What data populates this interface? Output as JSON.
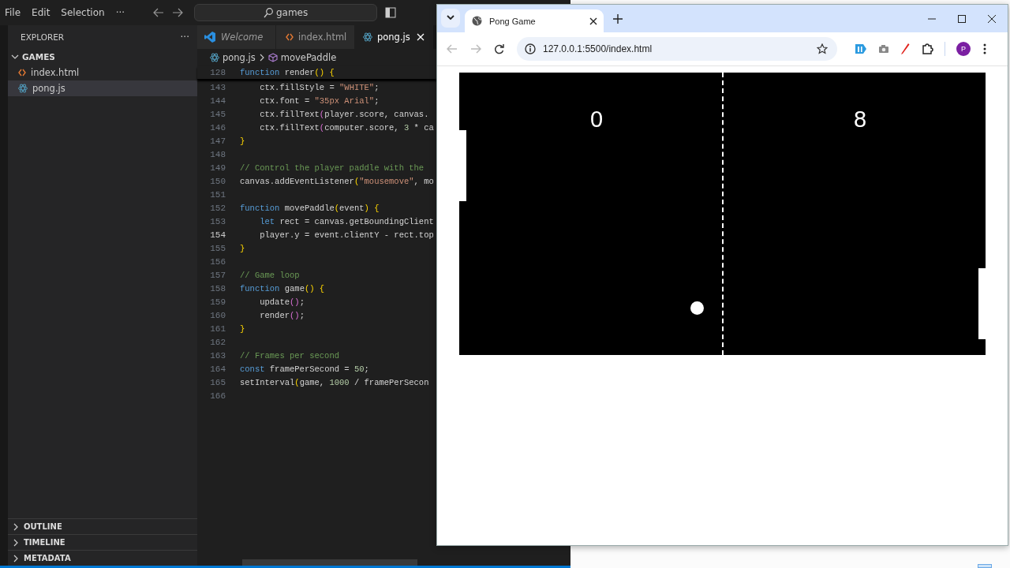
{
  "editor_window": {
    "menu": [
      "File",
      "Edit",
      "Selection",
      "···"
    ],
    "search": {
      "value": "games"
    },
    "explorer": {
      "title": "EXPLORER",
      "more": "···",
      "folder": {
        "name": "GAMES",
        "expanded": true,
        "children": [
          {
            "name": "index.html",
            "kind": "html",
            "selected": false
          },
          {
            "name": "pong.js",
            "kind": "js",
            "selected": true
          }
        ]
      }
    },
    "panels": [
      {
        "name": "OUTLINE",
        "expanded": false
      },
      {
        "name": "TIMELINE",
        "expanded": false
      },
      {
        "name": "METADATA",
        "expanded": false
      }
    ],
    "tabs": [
      {
        "label": "Welcome",
        "kind": "welcome",
        "selected": false
      },
      {
        "label": "index.html",
        "kind": "html",
        "selected": false
      },
      {
        "label": "pong.js",
        "kind": "js",
        "selected": true
      }
    ],
    "breadcrumb": [
      {
        "label": "pong.js",
        "kind": "js"
      },
      {
        "label": "movePaddle",
        "kind": "method"
      }
    ],
    "code": {
      "sticky": {
        "number": "128",
        "tokens": [
          {
            "kind": "kw",
            "text": "function"
          },
          {
            "kind": "p",
            "text": " render"
          },
          {
            "kind": "b1",
            "text": "() {"
          }
        ]
      },
      "lines": [
        {
          "number": "143",
          "current": false,
          "tokens": [
            {
              "kind": "p",
              "text": "    ctx.fillStyle = "
            },
            {
              "kind": "s",
              "text": "\"WHITE\""
            },
            {
              "kind": "p",
              "text": ";"
            }
          ]
        },
        {
          "number": "144",
          "current": false,
          "tokens": [
            {
              "kind": "p",
              "text": "    ctx.font = "
            },
            {
              "kind": "s",
              "text": "\"35px Arial\""
            },
            {
              "kind": "p",
              "text": ";"
            }
          ]
        },
        {
          "number": "145",
          "current": false,
          "tokens": [
            {
              "kind": "p",
              "text": "    ctx.fillText"
            },
            {
              "kind": "b2",
              "text": "("
            },
            {
              "kind": "p",
              "text": "player.score, canvas."
            }
          ]
        },
        {
          "number": "146",
          "current": false,
          "tokens": [
            {
              "kind": "p",
              "text": "    ctx.fillText"
            },
            {
              "kind": "b2",
              "text": "("
            },
            {
              "kind": "p",
              "text": "computer.score, "
            },
            {
              "kind": "n",
              "text": "3"
            },
            {
              "kind": "p",
              "text": " * ca"
            }
          ]
        },
        {
          "number": "147",
          "current": false,
          "tokens": [
            {
              "kind": "b1",
              "text": "}"
            }
          ]
        },
        {
          "number": "148",
          "current": false
        },
        {
          "number": "149",
          "current": false,
          "tokens": [
            {
              "kind": "c",
              "text": "// Control the player paddle with the"
            }
          ]
        },
        {
          "number": "150",
          "current": false,
          "tokens": [
            {
              "kind": "p",
              "text": "canvas.addEventListener"
            },
            {
              "kind": "b1",
              "text": "("
            },
            {
              "kind": "s",
              "text": "\"mousemove\""
            },
            {
              "kind": "p",
              "text": ", mo"
            }
          ]
        },
        {
          "number": "151",
          "current": false
        },
        {
          "number": "152",
          "current": false,
          "tokens": [
            {
              "kind": "kw",
              "text": "function"
            },
            {
              "kind": "p",
              "text": " movePaddle"
            },
            {
              "kind": "b1",
              "text": "("
            },
            {
              "kind": "p",
              "text": "event"
            },
            {
              "kind": "b1",
              "text": ") {"
            }
          ]
        },
        {
          "number": "153",
          "current": false,
          "tokens": [
            {
              "kind": "kw",
              "text": "    let"
            },
            {
              "kind": "p",
              "text": " rect = canvas.getBoundingClient"
            }
          ]
        },
        {
          "number": "154",
          "current": true,
          "tokens": [
            {
              "kind": "p",
              "text": "    player.y = event.clientY - rect.top"
            }
          ]
        },
        {
          "number": "155",
          "current": false,
          "tokens": [
            {
              "kind": "b1",
              "text": "}"
            }
          ]
        },
        {
          "number": "156",
          "current": false
        },
        {
          "number": "157",
          "current": false,
          "tokens": [
            {
              "kind": "c",
              "text": "// Game loop"
            }
          ]
        },
        {
          "number": "158",
          "current": false,
          "tokens": [
            {
              "kind": "kw",
              "text": "function"
            },
            {
              "kind": "p",
              "text": " game"
            },
            {
              "kind": "b1",
              "text": "() {"
            }
          ]
        },
        {
          "number": "159",
          "current": false,
          "tokens": [
            {
              "kind": "p",
              "text": "    update"
            },
            {
              "kind": "b2",
              "text": "()"
            },
            {
              "kind": "p",
              "text": ";"
            }
          ]
        },
        {
          "number": "160",
          "current": false,
          "tokens": [
            {
              "kind": "p",
              "text": "    render"
            },
            {
              "kind": "b2",
              "text": "()"
            },
            {
              "kind": "p",
              "text": ";"
            }
          ]
        },
        {
          "number": "161",
          "current": false,
          "tokens": [
            {
              "kind": "b1",
              "text": "}"
            }
          ]
        },
        {
          "number": "162",
          "current": false
        },
        {
          "number": "163",
          "current": false,
          "tokens": [
            {
              "kind": "c",
              "text": "// Frames per second"
            }
          ]
        },
        {
          "number": "164",
          "current": false,
          "tokens": [
            {
              "kind": "kw",
              "text": "const"
            },
            {
              "kind": "p",
              "text": " framePerSecond = "
            },
            {
              "kind": "n",
              "text": "50"
            },
            {
              "kind": "p",
              "text": ";"
            }
          ]
        },
        {
          "number": "165",
          "current": false,
          "tokens": [
            {
              "kind": "p",
              "text": "setInterval"
            },
            {
              "kind": "b1",
              "text": "("
            },
            {
              "kind": "p",
              "text": "game, "
            },
            {
              "kind": "n",
              "text": "1000"
            },
            {
              "kind": "p",
              "text": " / framePerSecon"
            }
          ]
        },
        {
          "number": "166",
          "current": false
        }
      ]
    }
  },
  "browser_window": {
    "tab": {
      "title": "Pong Game",
      "selected": true
    },
    "address": "127.0.0.1:5500/index.html",
    "profile": "P",
    "game": {
      "scores": [
        "0",
        "8"
      ]
    }
  }
}
